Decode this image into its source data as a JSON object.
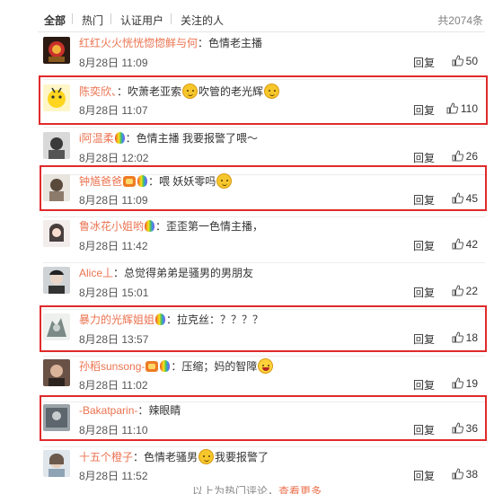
{
  "filter_tabs": [
    "全部",
    "热门",
    "认证用户",
    "关注的人"
  ],
  "total_count": "共2074条",
  "reply_label": "回复",
  "comments": [
    {
      "user": "红红火火恍恍惚惚鲜与何",
      "text": "：色情老主播",
      "time": "8月28日 11:09",
      "likes": "50",
      "highlighted": false
    },
    {
      "user": "陈奕欣、",
      "text": "：吹萧老亚索",
      "text2": "吹管的老光辉",
      "time": "8月28日 11:07",
      "likes": "110",
      "highlighted": true
    },
    {
      "user": "i阿温柔",
      "text": "：色情主播 我要报警了喂～",
      "time": "8月28日 12:02",
      "likes": "26",
      "highlighted": false
    },
    {
      "user": "钟馗爸爸",
      "text": "：喂  妖妖零吗",
      "time": "8月28日 11:09",
      "likes": "45",
      "highlighted": true
    },
    {
      "user": "鲁冰花小姐哟",
      "text": "：歪歪第一色情主播，",
      "time": "8月28日 11:42",
      "likes": "42",
      "highlighted": false
    },
    {
      "user": "Alice丄",
      "text": "：总觉得弟弟是骚男的男朋友",
      "time": "8月28日 15:01",
      "likes": "22",
      "highlighted": false
    },
    {
      "user": "暴力的光辉姐姐",
      "text": "：拉克丝：？？？？",
      "time": "8月28日 13:57",
      "likes": "18",
      "highlighted": true
    },
    {
      "user": "孙稻sunsong-",
      "text": "：压缩；妈的智障",
      "time": "8月28日 11:02",
      "likes": "19",
      "highlighted": false
    },
    {
      "user": "-Bakatparin-",
      "text": "：辣眼睛",
      "time": "8月28日 11:10",
      "likes": "36",
      "highlighted": true
    },
    {
      "user": "十五个橙子",
      "text": "：色情老骚男",
      "text2": "我要报警了",
      "time": "8月28日 11:52",
      "likes": "38",
      "highlighted": false
    }
  ],
  "bottom_hint": "以上为热门评论，",
  "bottom_more": "查看更多",
  "colors": {
    "username": "#eb7350",
    "highlight_border": "#e02a2a",
    "divider": "#ececec"
  }
}
